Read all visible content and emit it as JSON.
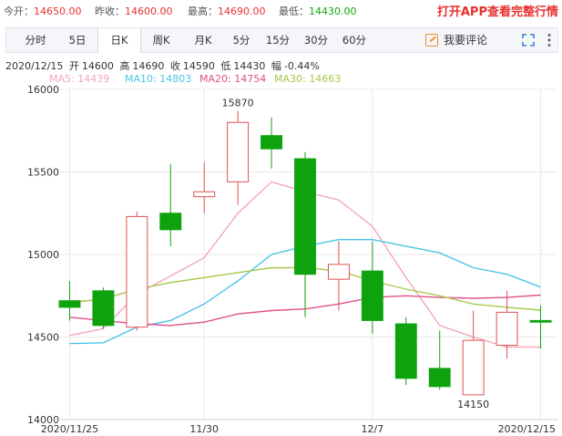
{
  "quote": {
    "open_label": "今开：",
    "open_value": "14650.00",
    "prev_close_label": "昨收：",
    "prev_close_value": "14600.00",
    "high_label": "最高：",
    "high_value": "14690.00",
    "low_label": "最低：",
    "low_value": "14430.00",
    "app_link": "打开APP查看完整行情"
  },
  "tabs": [
    {
      "label": "分时",
      "active": false
    },
    {
      "label": "5日",
      "active": false
    },
    {
      "label": "日K",
      "active": true
    },
    {
      "label": "周K",
      "active": false
    },
    {
      "label": "月K",
      "active": false
    },
    {
      "label": "5分",
      "active": false
    },
    {
      "label": "15分",
      "active": false
    },
    {
      "label": "30分",
      "active": false
    },
    {
      "label": "60分",
      "active": false
    }
  ],
  "toolbar": {
    "comment_label": "我要评论",
    "comment_icon": "pencil-icon",
    "expand_icon": "expand-icon",
    "more_icon": "more-icon"
  },
  "ohlc": {
    "date": "2020/12/15",
    "open_label": "开",
    "open": "14600",
    "high_label": "高",
    "high": "14690",
    "close_label": "收",
    "close": "14590",
    "low_label": "低",
    "low": "14430",
    "change_label": "幅",
    "change": "-0.44%"
  },
  "colors": {
    "up": "#e05050",
    "down": "#0ea30e",
    "ma5": "#f4a7b9",
    "ma10": "#4cc3e6",
    "ma20": "#e0508c",
    "ma30": "#a7c94a",
    "grid": "#e8e8e8",
    "axis_text": "#333333"
  },
  "chart_data": {
    "type": "candlestick",
    "ylim": [
      14000,
      16000
    ],
    "yticks": [
      14000,
      14500,
      15000,
      15500,
      16000
    ],
    "grid": true,
    "xtick_labels": [
      {
        "index": 0,
        "label": "2020/11/25"
      },
      {
        "index": 4,
        "label": "11/30"
      },
      {
        "index": 9,
        "label": "12/7"
      },
      {
        "index": 14,
        "label": "2020/12/15"
      }
    ],
    "candles": [
      {
        "open": 14720,
        "high": 14840,
        "low": 14600,
        "close": 14680
      },
      {
        "open": 14780,
        "high": 14800,
        "low": 14550,
        "close": 14570
      },
      {
        "open": 14560,
        "high": 15260,
        "low": 14540,
        "close": 15230
      },
      {
        "open": 15250,
        "high": 15550,
        "low": 15050,
        "close": 15150
      },
      {
        "open": 15350,
        "high": 15560,
        "low": 15250,
        "close": 15380
      },
      {
        "open": 15440,
        "high": 15870,
        "low": 15300,
        "close": 15800
      },
      {
        "open": 15720,
        "high": 15830,
        "low": 15520,
        "close": 15640
      },
      {
        "open": 15580,
        "high": 15620,
        "low": 14620,
        "close": 14880
      },
      {
        "open": 14850,
        "high": 15080,
        "low": 14660,
        "close": 14940
      },
      {
        "open": 14900,
        "high": 15080,
        "low": 14520,
        "close": 14600
      },
      {
        "open": 14580,
        "high": 14620,
        "low": 14210,
        "close": 14250
      },
      {
        "open": 14310,
        "high": 14540,
        "low": 14180,
        "close": 14200
      },
      {
        "open": 14150,
        "high": 14660,
        "low": 14150,
        "close": 14480
      },
      {
        "open": 14450,
        "high": 14780,
        "low": 14370,
        "close": 14650
      },
      {
        "open": 14600,
        "high": 14690,
        "low": 14430,
        "close": 14590
      }
    ],
    "annotations": [
      {
        "index": 5,
        "value": 15870,
        "label": "15870",
        "position": "above"
      },
      {
        "index": 12,
        "value": 14150,
        "label": "14150",
        "position": "below"
      }
    ],
    "series": [
      {
        "name": "MA5",
        "legend_value": "14439",
        "color_key": "ma5",
        "values": [
          14510,
          14550,
          14760,
          14870,
          14980,
          15250,
          15440,
          15380,
          15330,
          15170,
          14860,
          14570,
          14500,
          14440,
          14439
        ]
      },
      {
        "name": "MA10",
        "legend_value": "14803",
        "color_key": "ma10",
        "values": [
          14460,
          14465,
          14560,
          14600,
          14700,
          14840,
          15000,
          15050,
          15090,
          15090,
          15050,
          15010,
          14920,
          14880,
          14803
        ]
      },
      {
        "name": "MA20",
        "legend_value": "14754",
        "color_key": "ma20",
        "values": [
          14620,
          14600,
          14580,
          14570,
          14590,
          14640,
          14660,
          14670,
          14700,
          14740,
          14750,
          14740,
          14735,
          14740,
          14754
        ]
      },
      {
        "name": "MA30",
        "legend_value": "14663",
        "color_key": "ma30",
        "values": [
          14710,
          14730,
          14790,
          14830,
          14860,
          14890,
          14920,
          14920,
          14900,
          14840,
          14790,
          14750,
          14700,
          14680,
          14663
        ]
      }
    ]
  }
}
